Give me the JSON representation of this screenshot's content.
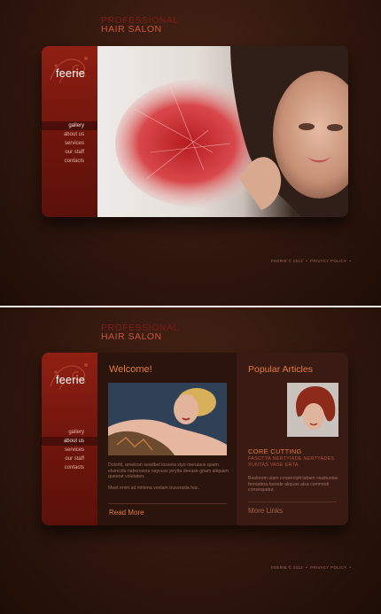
{
  "brand": {
    "line1": "PROFESSIONAL",
    "line2": "HAIR SALON"
  },
  "logo": "feerie",
  "nav": [
    "gallery",
    "about us",
    "services",
    "our staff",
    "contacts"
  ],
  "top": {
    "active_nav": "gallery"
  },
  "bottom": {
    "active_nav": "about us",
    "welcome_title": "Welcome!",
    "welcome_text": "Dolorlit, ametcon seadbet losseta styo meruiace quam eluincidu nabcrewna nayvuss jerytta deease gnam aliquam queerat volutaten.",
    "welcome_text2": "Meet enim ad minima venlam trusenstla hac.",
    "read_more": "Read More",
    "popular_title": "Popular Articles",
    "article_title": "CORE CUTTING",
    "article_subtitle": "FASCTYA NERTYIADE NERTYADES XUNTAS VASE ERTA",
    "article_text": "Baslorem ulam corpercipit labam siusbustas fernadera herede aliquas aisa commodi consequatur.",
    "more_links": "More Links"
  },
  "footer": {
    "text": "FEERIE © 2012",
    "privacy": "PRIVACY POLICY"
  },
  "colors": {
    "accent": "#e27a3d",
    "sidebar_red": "#8f1f13",
    "background": "#34190f"
  }
}
